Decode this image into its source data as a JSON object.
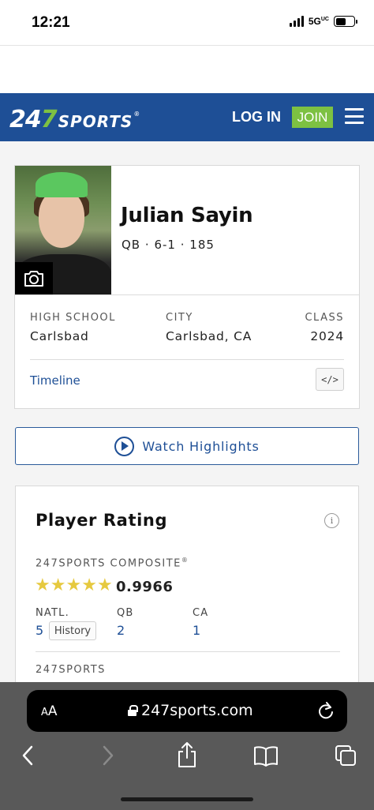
{
  "status_bar": {
    "time": "12:21",
    "network": "5G",
    "network_suffix": "UC",
    "battery_level": 0.55
  },
  "header": {
    "logo_number_a": "24",
    "logo_number_b": "7",
    "logo_word": "SPORTS",
    "logo_tm": "®",
    "login_label": "LOG IN",
    "join_label": "JOIN",
    "menu_icon": "hamburger-menu-icon",
    "brand_color": "#1e4f96",
    "accent_color": "#7dc142"
  },
  "player": {
    "name": "Julian Sayin",
    "position": "QB",
    "height": "6-1",
    "weight": "185",
    "meta_separator": "·",
    "camera_icon": "camera-icon",
    "high_school_label": "HIGH SCHOOL",
    "high_school": "Carlsbad",
    "city_label": "CITY",
    "city": "Carlsbad, CA",
    "class_label": "CLASS",
    "class": "2024",
    "timeline_label": "Timeline",
    "embed_label": "</>"
  },
  "highlights": {
    "label": "Watch Highlights",
    "icon": "play-circle-icon"
  },
  "rating": {
    "title": "Player Rating",
    "info_glyph": "i",
    "composite_label": "247SPORTS COMPOSITE",
    "composite_reg": "®",
    "stars": 5,
    "star_glyph": "★",
    "score": "0.9966",
    "natl_label": "NATL.",
    "natl_rank": "5",
    "history_label": "History",
    "pos_label": "QB",
    "pos_rank": "2",
    "state_label": "CA",
    "state_rank": "1",
    "sub_label": "247SPORTS",
    "star_color": "#e6c93f"
  },
  "browser": {
    "aa_small": "A",
    "aa_big": "A",
    "url": "247sports.com",
    "reload_icon": "reload-icon",
    "back_icon": "back-chevron-icon",
    "forward_icon": "forward-chevron-icon",
    "share_icon": "share-icon",
    "bookmarks_icon": "bookmarks-icon",
    "tabs_icon": "tabs-icon"
  }
}
